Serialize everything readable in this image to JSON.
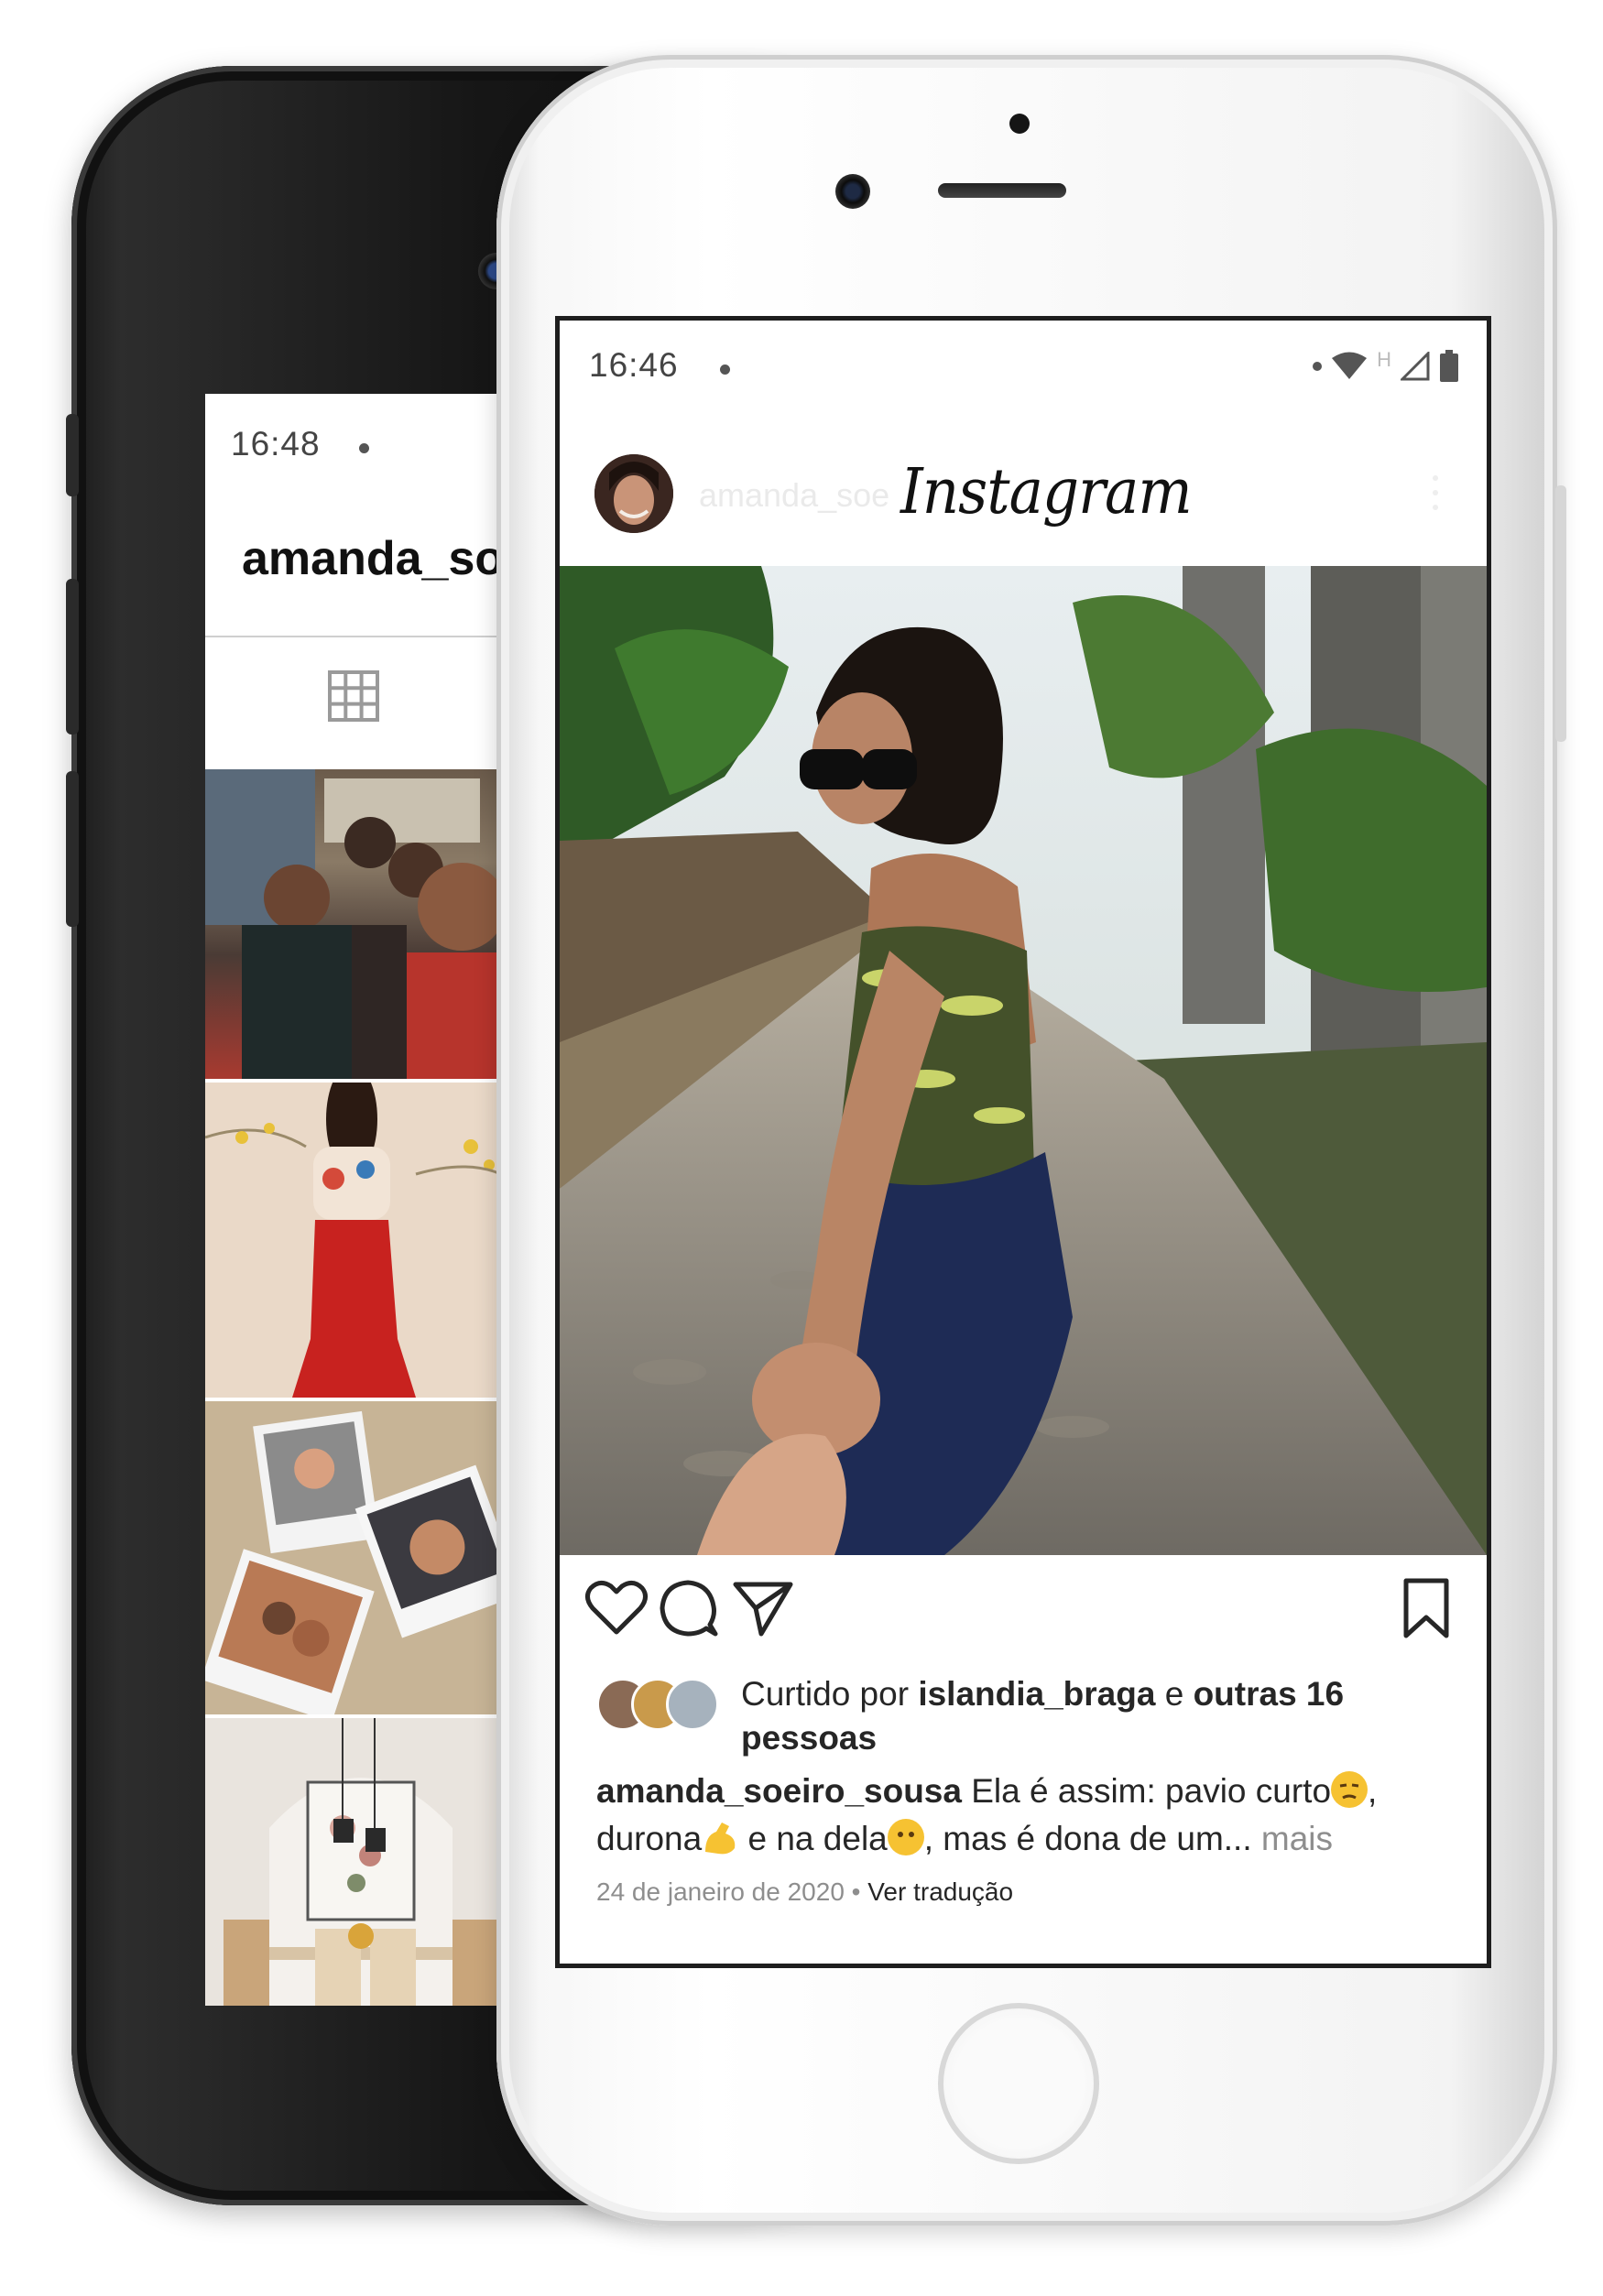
{
  "back_phone": {
    "status_time": "16:48",
    "username": "amanda_soeir",
    "tab_icon": "grid-icon"
  },
  "front_phone": {
    "status_time": "16:46",
    "status_network": "H",
    "app_logo": "Instagram",
    "header_username": "amanda_soe",
    "likes": {
      "prefix": "Curtido por ",
      "user": "islandia_braga",
      "middle": " e ",
      "others": "outras 16 pessoas"
    },
    "caption": {
      "user": "amanda_soeiro_sousa",
      "text_1": " Ela é assim: pavio curto",
      "text_2": ", durona",
      "text_3": " e na dela",
      "text_4": ", mas é dona de um",
      "ellipsis": "...",
      "more": " mais"
    },
    "date": "24 de janeiro de 2020",
    "separator": " • ",
    "translate": "Ver tradução"
  },
  "icons": {
    "like": "heart-icon",
    "comment": "comment-icon",
    "share": "send-icon",
    "save": "bookmark-icon"
  }
}
